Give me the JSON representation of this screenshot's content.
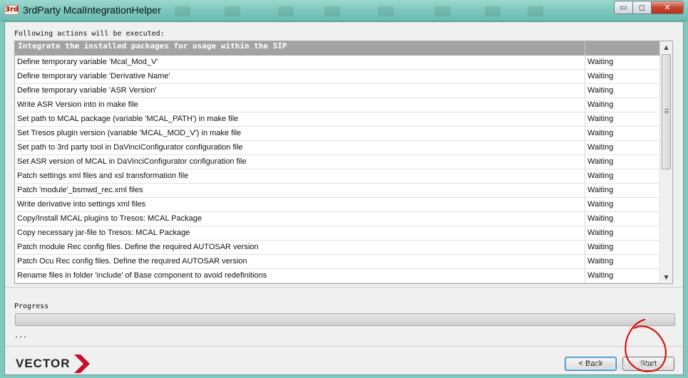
{
  "window": {
    "icon_text": "3rd",
    "title": "3rdParty McalIntegrationHelper",
    "minimize_glyph": "▭",
    "maximize_glyph": "◻",
    "close_glyph": "✕"
  },
  "actions": {
    "intro": "Following actions will be executed:",
    "header": "Integrate the installed packages for usage within the SIP",
    "rows": [
      {
        "action": "Define temporary variable 'Mcal_Mod_V'",
        "status": "Waiting"
      },
      {
        "action": "Define temporary variable 'Derivative Name'",
        "status": "Waiting"
      },
      {
        "action": "Define temporary variable 'ASR Version'",
        "status": "Waiting"
      },
      {
        "action": "Write ASR Version into in make file",
        "status": "Waiting"
      },
      {
        "action": "Set path to MCAL package (variable 'MCAL_PATH') in make file",
        "status": "Waiting"
      },
      {
        "action": "Set Tresos plugin version (variable 'MCAL_MOD_V') in make file",
        "status": "Waiting"
      },
      {
        "action": "Set path to 3rd party tool in DaVinciConfigurator configuration file",
        "status": "Waiting"
      },
      {
        "action": "Set ASR version of MCAL in DaVinciConfigurator configuration file",
        "status": "Waiting"
      },
      {
        "action": "Patch settings xml files and xsl transformation file",
        "status": "Waiting"
      },
      {
        "action": "Patch 'module'_bsmwd_rec.xml files",
        "status": "Waiting"
      },
      {
        "action": "Write derivative into settings xml files",
        "status": "Waiting"
      },
      {
        "action": "Copy/Install MCAL plugins to Tresos: MCAL Package",
        "status": "Waiting"
      },
      {
        "action": "Copy necessary jar-file to Tresos: MCAL Package",
        "status": "Waiting"
      },
      {
        "action": "Patch module Rec config files. Define the required AUTOSAR version",
        "status": "Waiting"
      },
      {
        "action": "Patch Ocu Rec config files. Define the required AUTOSAR version",
        "status": "Waiting"
      },
      {
        "action": "Rename files in folder 'include' of Base component to avoid redefinitions",
        "status": "Waiting"
      }
    ]
  },
  "progress": {
    "label": "Progress",
    "fraction": 0,
    "status_text": "..."
  },
  "footer": {
    "logo_text": "VECTOR",
    "back_label": "< Back",
    "start_label": "Start",
    "watermark": "CSDN @木子山林"
  },
  "colors": {
    "logo_arrow": "#c8102e",
    "annotation": "#e00000",
    "header_bg": "#a3a3a3"
  }
}
